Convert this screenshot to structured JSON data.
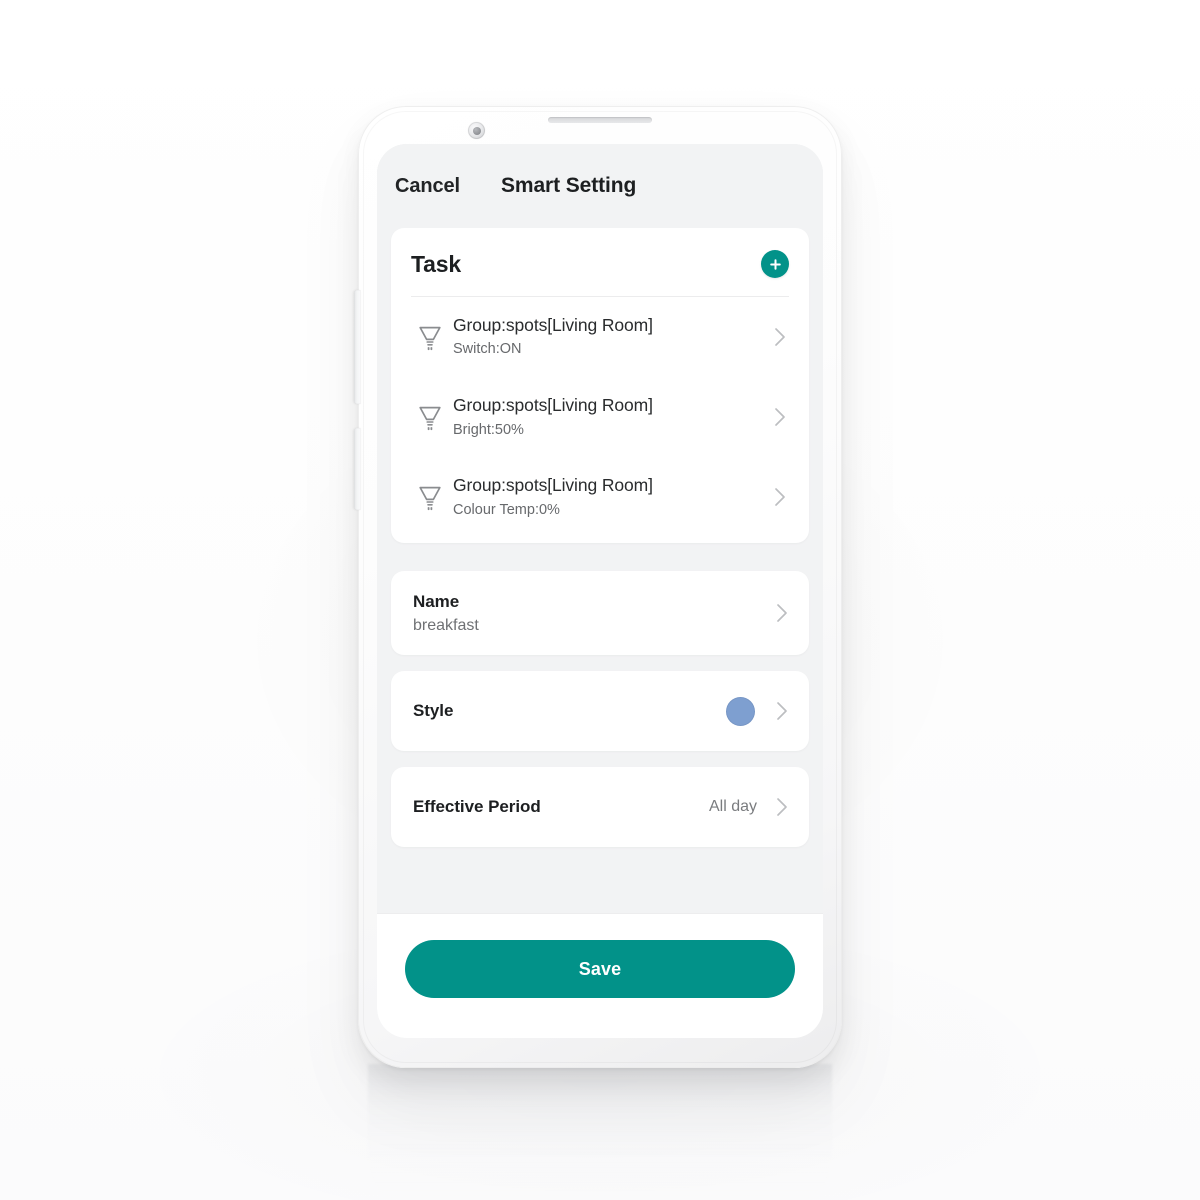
{
  "app": {
    "navbar": {
      "cancel_label": "Cancel",
      "title": "Smart Setting"
    },
    "task_section": {
      "title": "Task",
      "add_icon": "plus-circle-icon",
      "add_label": "+",
      "rows": [
        {
          "icon": "spotlight-bulb-icon",
          "primary": "Group:spots[Living Room]",
          "secondary": "Switch:ON",
          "chevron": "chevron-right-icon"
        },
        {
          "icon": "spotlight-bulb-icon",
          "primary": "Group:spots[Living Room]",
          "secondary": "Bright:50%",
          "chevron": "chevron-right-icon"
        },
        {
          "icon": "spotlight-bulb-icon",
          "primary": "Group:spots[Living Room]",
          "secondary": "Colour Temp:0%",
          "chevron": "chevron-right-icon"
        }
      ]
    },
    "settings": {
      "name": {
        "label": "Name",
        "value": "breakfast",
        "chevron": "chevron-right-icon"
      },
      "style": {
        "label": "Style",
        "swatch_color": "#7e9fd0",
        "chevron": "chevron-right-icon"
      },
      "effective_period": {
        "label": "Effective Period",
        "value": "All day",
        "chevron": "chevron-right-icon"
      }
    },
    "footer": {
      "save_label": "Save"
    }
  },
  "theme": {
    "accent": "#029289",
    "screen_bg": "#f2f3f4",
    "card_bg": "#ffffff",
    "text_primary": "#1d1f21",
    "text_secondary": "#6f7174",
    "chevron_color": "#bcbec1",
    "style_swatch": "#7e9fd0"
  },
  "device": {
    "hardware": {
      "earpiece": "earpiece-speaker",
      "camera": "front-camera",
      "volume_button": "volume-rocker",
      "power_button": "power-button"
    }
  }
}
